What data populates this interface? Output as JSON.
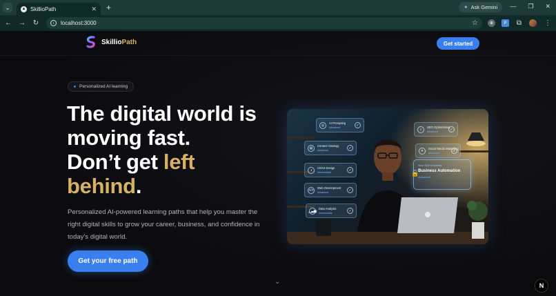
{
  "browser": {
    "tab_title": "SkillioPath",
    "new_tab": "+",
    "ask_gemini": "Ask Gemini",
    "url": "localhost:3000"
  },
  "nav": {
    "brand_first": "Skillio",
    "brand_second": "Path",
    "get_started": "Get started"
  },
  "hero": {
    "badge": "Personalized AI learning",
    "title_line1": "The digital world is",
    "title_line2": "moving fast.",
    "title_line3_pre": "Don’t get ",
    "title_line3_accent": "left",
    "title_line4_accent": "behind",
    "title_line4_post": ".",
    "subtitle": "Personalized AI-powered learning paths that help you master the right digital skills to grow your career, business, and confidence in today's digital world.",
    "cta": "Get your free path"
  },
  "hero_image": {
    "cards_left": [
      {
        "title": "AI Prompting",
        "level": "Advanced"
      },
      {
        "title": "Content Strategy",
        "level": "Advanced"
      },
      {
        "title": "UX/UI Design",
        "level": "Intermediate"
      },
      {
        "title": "Web Development",
        "level": "Advanced"
      },
      {
        "title": "Data Analysis",
        "level": "Intermediate"
      }
    ],
    "cards_right": [
      {
        "title": "SEO Optimization",
        "level": "Advanced"
      },
      {
        "title": "Social Media Marketing",
        "level": "Advanced"
      }
    ],
    "skill_card": {
      "kicker": "Your Skill Unlocked",
      "name": "Business Automation",
      "level": "Advanced"
    }
  },
  "colors": {
    "accent_blue": "#3a7ff0",
    "accent_gold": "#d7b264",
    "background": "#0d0d10"
  },
  "icons": [
    "tab-menu-icon",
    "favicon-icon",
    "close-icon",
    "back-icon",
    "forward-icon",
    "reload-icon",
    "site-info-icon",
    "bookmark-star-icon",
    "extensions-icon",
    "profile-avatar-icon",
    "menu-kebab-icon",
    "chevron-down-icon",
    "nextjs-icon"
  ]
}
